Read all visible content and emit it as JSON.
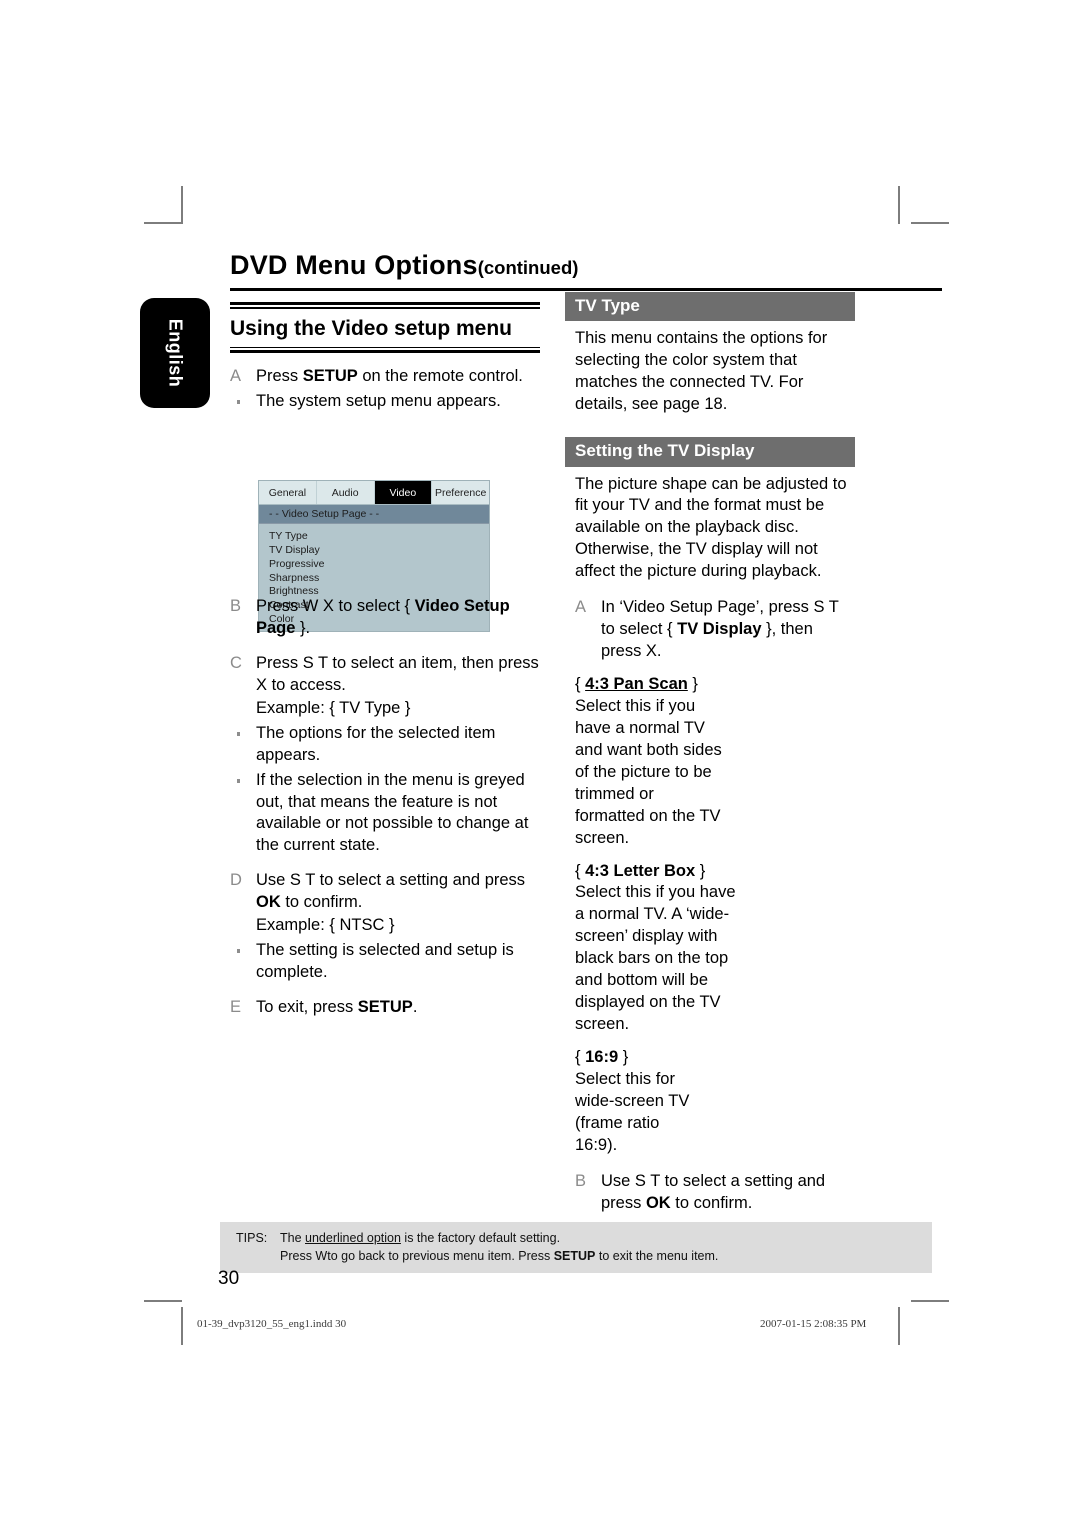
{
  "running_head": {
    "title": "DVD Menu Options",
    "continued": "(continued)"
  },
  "language_tab": "English",
  "left_column": {
    "section_title": "Using the Video setup menu",
    "steps": [
      {
        "letter": "A",
        "html": "Press <b>SETUP</b> on the remote control.",
        "text": "Press SETUP on the remote control."
      },
      {
        "letter": "B",
        "html": "Press  W X to select { <b>Video Setup Page</b> }.",
        "text": "Press W X to select { Video Setup Page }."
      },
      {
        "letter": "C",
        "html": "Press  S  T to select an item, then press  X to access.",
        "text": "Press S T to select an item, then press X to access."
      },
      {
        "letter": "D",
        "html": "Use  S  T to select a setting and press <b>OK</b> to confirm.",
        "text": "Use S T to select a setting and press OK to confirm."
      },
      {
        "letter": "E",
        "html": "To exit, press <b>SETUP</b>.",
        "text": "To exit, press SETUP."
      }
    ],
    "bullet_a": "The system setup menu appears.",
    "example_c": "Example: { TV Type }",
    "bullet_c1": "The options for the selected item appears.",
    "bullet_c2": "If the selection in the menu is greyed out, that means the feature is not available or not possible to change at the current state.",
    "example_d": "Example: { NTSC }",
    "bullet_d1": "The setting is selected and setup is complete."
  },
  "osd": {
    "tabs": [
      {
        "label": "General",
        "active": false
      },
      {
        "label": "Audio",
        "active": false
      },
      {
        "label": "Video",
        "active": true
      },
      {
        "label": "Preference",
        "active": false
      }
    ],
    "page_bar": "- -  Video Setup Page   - -",
    "items": [
      "TY Type",
      "TV Display",
      "Progressive",
      "Sharpness",
      "Brightness",
      "Contrast",
      "Color"
    ]
  },
  "right_column": {
    "tv_type": {
      "heading": "TV Type",
      "body": "This menu contains the options for selecting the color system that matches the connected TV. For details, see page 18."
    },
    "tv_display": {
      "heading": "Setting the TV Display",
      "body": "The picture shape can be adjusted to fit your TV and the format must be available on the playback disc. Otherwise, the TV display will not affect the picture during playback.",
      "step_a_letter": "A",
      "step_a_html": "In ‘Video Setup Page’, press  S  T to select { <b>TV Display</b> }, then press  X.",
      "step_a_text": "In 'Video Setup Page', press S T to select { TV Display }, then press X.",
      "options": [
        {
          "name": "4:3 Pan Scan",
          "underlined": true,
          "body": "Select this if you have a normal TV and want both sides of the picture to be trimmed or formatted on the TV screen."
        },
        {
          "name": "4:3 Letter Box",
          "underlined": false,
          "body": "Select this if you have a normal TV. A  ‘wide-screen’ display with black bars on the top and bottom will be displayed on the TV screen."
        },
        {
          "name": "16:9",
          "underlined": false,
          "body": "Select this for wide-screen TV (frame ratio 16:9)."
        }
      ],
      "step_b_letter": "B",
      "step_b_html": "Use  S  T to select a setting and press <b>OK</b> to confirm.",
      "step_b_text": "Use S T to select a setting and press OK to confirm."
    }
  },
  "tips": {
    "label": "TIPS:",
    "line1_html": "The <u>underlined option</u> is the factory default setting.",
    "line1_text": "The underlined option is the factory default setting.",
    "line2_html": "Press  Wto go back to previous menu item. Press <b>SETUP</b> to exit the menu item.",
    "line2_text": "Press Wto go back to previous menu item. Press SETUP to exit the menu item."
  },
  "folio": "30",
  "imprint": {
    "left": "01-39_dvp3120_55_eng1.indd   30",
    "right": "2007-01-15   2:08:35 PM"
  },
  "colors": {
    "gray_bar": "#6e6e6e",
    "tips_bg": "#dcdcdc",
    "osd_body": "#b3c6cc",
    "osd_tabbar": "#dce8ea",
    "osd_pagebar": "#70889a",
    "step_letter": "#8b8b8b"
  }
}
